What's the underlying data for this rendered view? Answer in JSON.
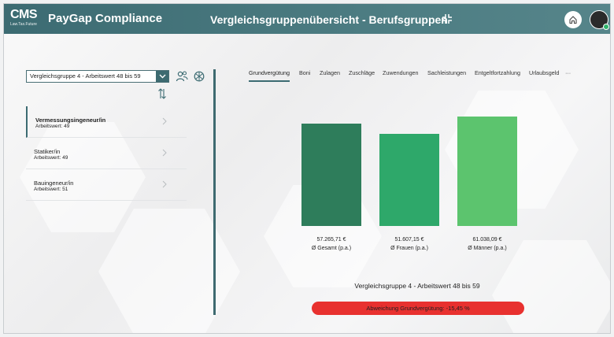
{
  "header": {
    "logo_text": "CMS",
    "logo_tagline": "Law.Tax.Future",
    "app_title": "PayGap Compliance",
    "page_title": "Vergleichsgruppenübersicht - Berufsgruppen",
    "icons": [
      "collapse-icon",
      "home-icon",
      "avatar"
    ]
  },
  "sidebar": {
    "group_select": "Vergleichsgruppe 4 - Arbeitswert 48 bis 59",
    "items": [
      {
        "title": "Vermessungsingeneur/in",
        "subtitle": "Arbeitswert: 49",
        "active": true
      },
      {
        "title": "Statiker/in",
        "subtitle": "Arbeitswert: 49",
        "active": false
      },
      {
        "title": "Bauingeneur/in",
        "subtitle": "Arbeitswert: 51",
        "active": false
      }
    ]
  },
  "tabs": [
    {
      "label": "Grundvergütung",
      "active": true
    },
    {
      "label": "Boni"
    },
    {
      "label": "Zulagen"
    },
    {
      "label": "Zuschläge"
    },
    {
      "label": "Zuwendungen"
    },
    {
      "label": "Sachleistungen"
    },
    {
      "label": "Entgeltfortzahlung"
    },
    {
      "label": "Urlaubsgeld"
    },
    {
      "label": "···"
    }
  ],
  "chart_data": {
    "type": "bar",
    "categories": [
      "Ø Gesamt (p.a.)",
      "Ø Frauen (p.a.)",
      "Ø Männer (p.a.)"
    ],
    "values": [
      57265.71,
      51607.15,
      61038.09
    ],
    "value_labels": [
      "57.265,71 €",
      "51.607,15 €",
      "61.038,09 €"
    ],
    "colors": [
      "#2e7d5b",
      "#2ea86a",
      "#5cc46e"
    ],
    "ylim": [
      0,
      66000
    ],
    "title": "Vergleichsgruppe 4 - Arbeitswert 48 bis 59"
  },
  "deviation": {
    "label": "Abweichung Grundvergütung: -15,45 %",
    "color": "#e8312f"
  },
  "colors": {
    "brand": "#3c6b72"
  }
}
